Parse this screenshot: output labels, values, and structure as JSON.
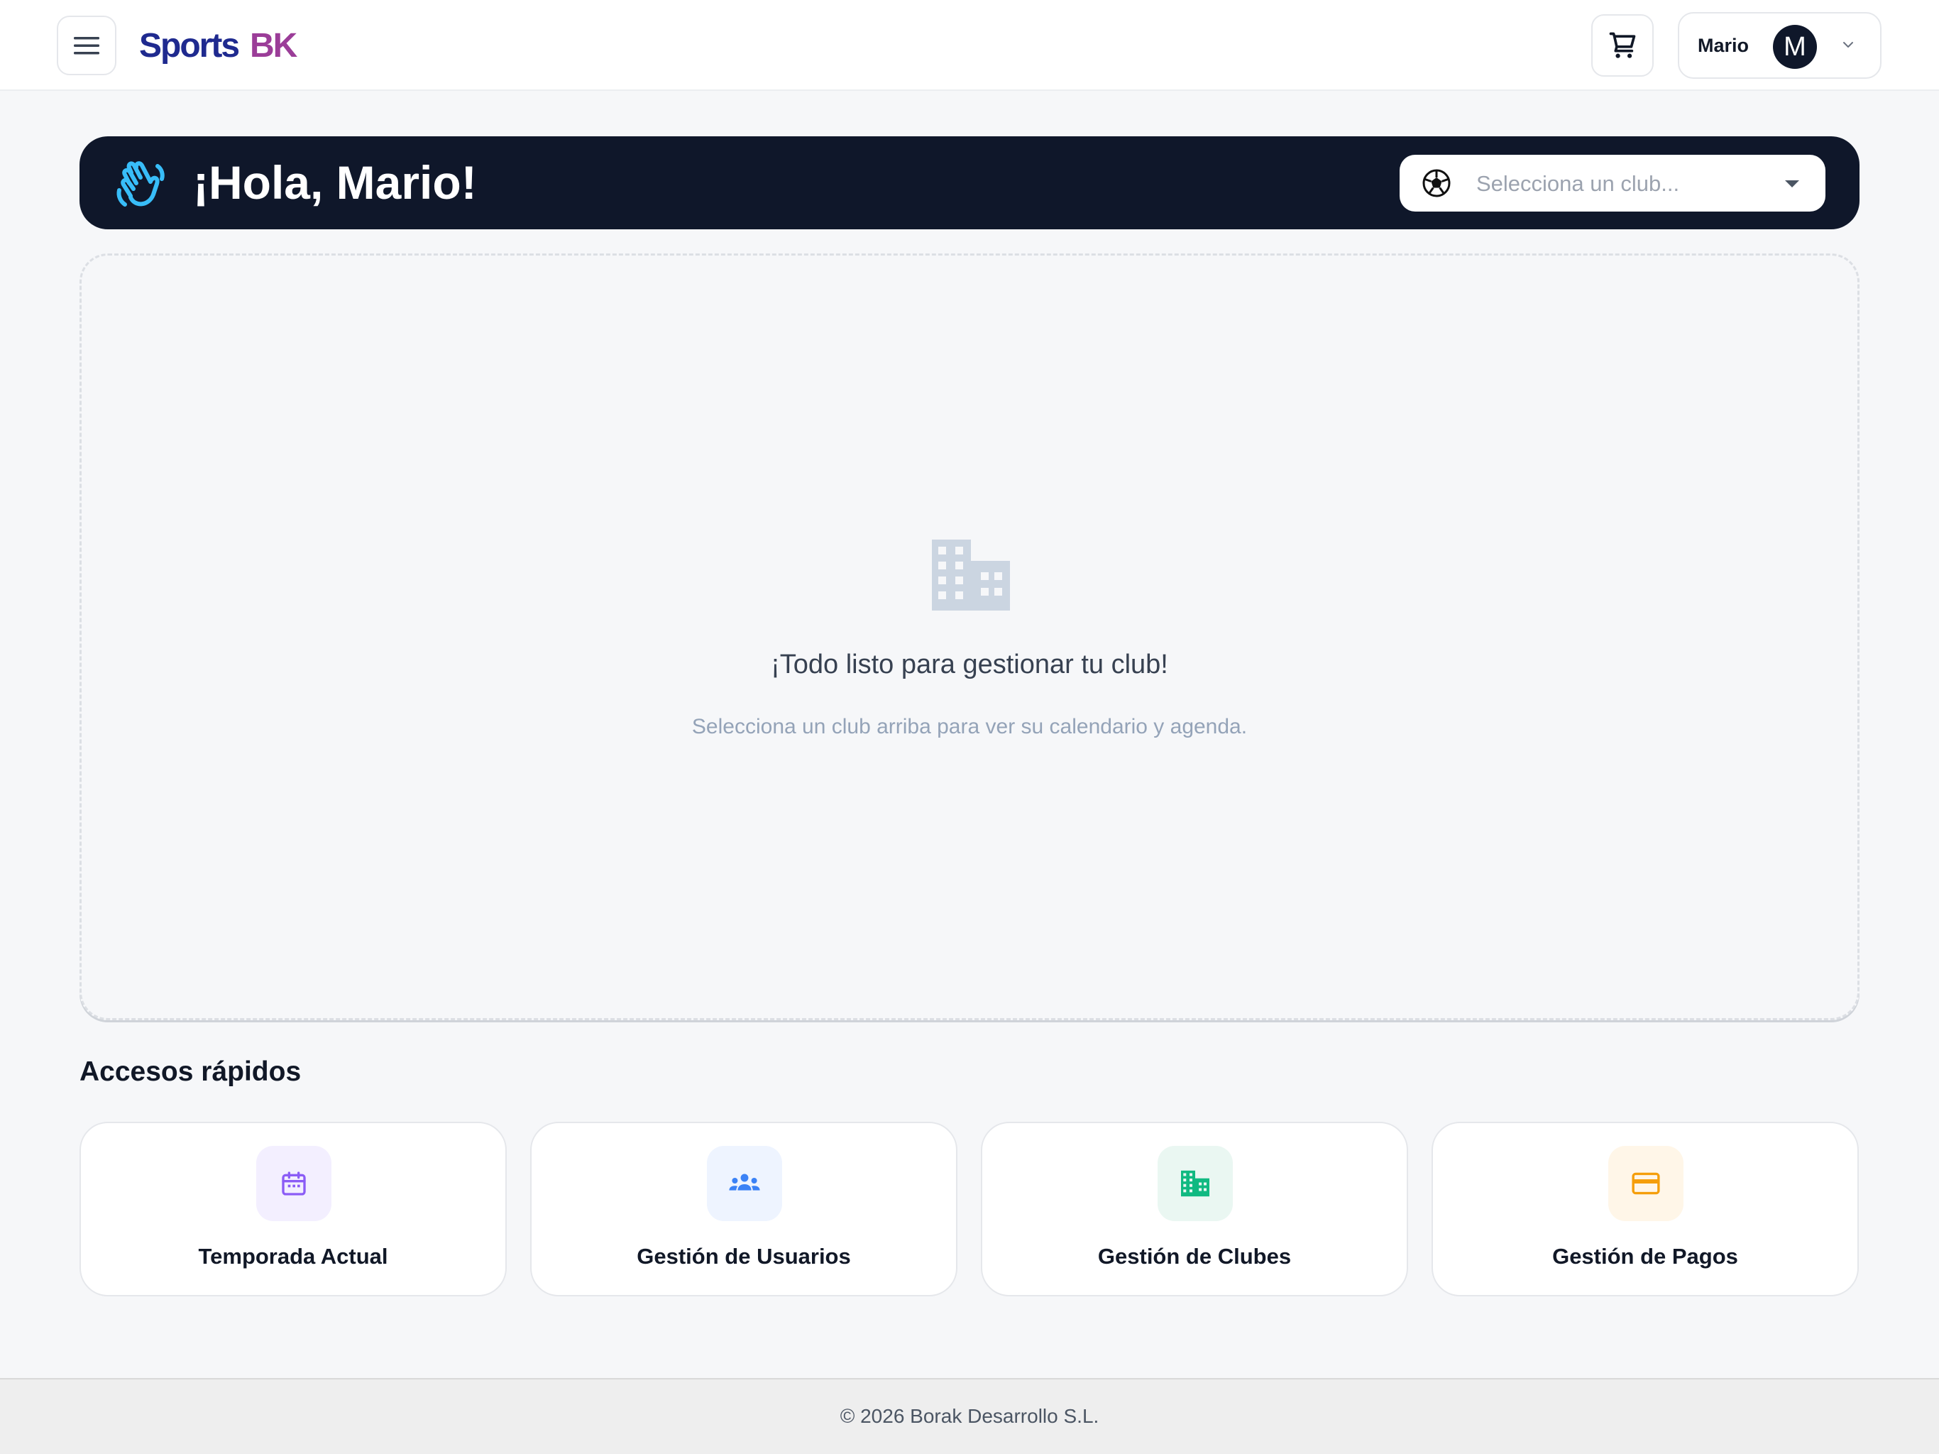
{
  "header": {
    "brand_part1": "Sports",
    "brand_part2": "BK",
    "user_name": "Mario",
    "avatar_initial": "M",
    "menu_icon": "hamburger-icon",
    "cart_icon": "shopping-cart-icon",
    "user_menu_icon": "chevron-down-icon"
  },
  "banner": {
    "greeting": "¡Hola, Mario!",
    "wave_icon": "waving-hand-icon",
    "club_select": {
      "placeholder": "Selecciona un club...",
      "icon": "soccer-ball-icon",
      "caret_icon": "caret-down-icon"
    }
  },
  "empty_state": {
    "icon": "building-icon",
    "title": "¡Todo listo para gestionar tu club!",
    "subtitle": "Selecciona un club arriba para ver su calendario y agenda."
  },
  "quick_access": {
    "title": "Accesos rápidos",
    "items": [
      {
        "label": "Temporada Actual",
        "icon": "calendar-icon",
        "color": "#8b5cf6",
        "bg": "#f3efff"
      },
      {
        "label": "Gestión de Usuarios",
        "icon": "users-icon",
        "color": "#3b82f6",
        "bg": "#eef4ff"
      },
      {
        "label": "Gestión de Clubes",
        "icon": "building-icon",
        "color": "#10b981",
        "bg": "#eaf7f2"
      },
      {
        "label": "Gestión de Pagos",
        "icon": "credit-card-icon",
        "color": "#f59e0b",
        "bg": "#fff6e8"
      }
    ]
  },
  "footer": {
    "copyright": "© 2026 Borak Desarrollo S.L."
  },
  "colors": {
    "banner_bg": "#0f172a",
    "brand_primary": "#1f2a8f",
    "brand_accent": "#9b3d98",
    "wave_icon": "#38bdf8"
  }
}
